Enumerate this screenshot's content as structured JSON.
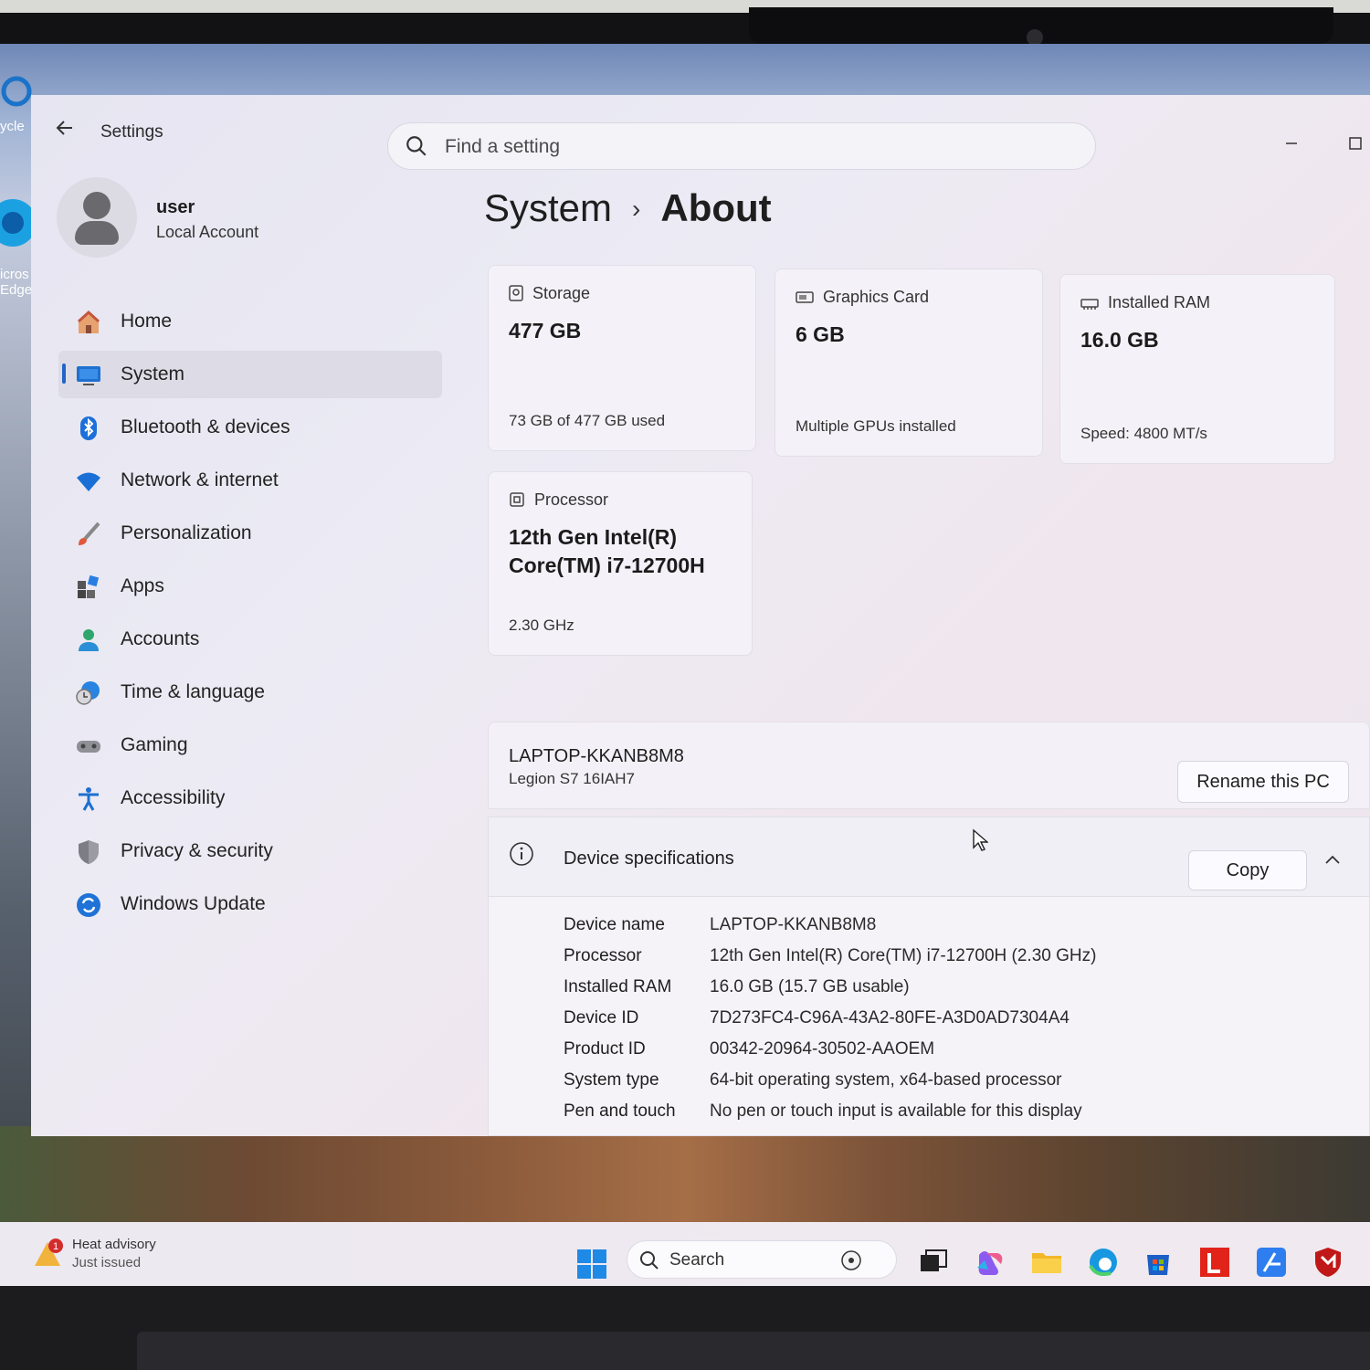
{
  "desktop": {
    "recycle_label": "ycle",
    "edge_label_1": "icros",
    "edge_label_2": "Edge"
  },
  "window": {
    "app_title": "Settings",
    "search_placeholder": "Find a setting"
  },
  "user": {
    "name": "user",
    "account_type": "Local Account"
  },
  "sidebar": {
    "items": [
      {
        "label": "Home",
        "icon": "home-icon"
      },
      {
        "label": "System",
        "icon": "system-icon",
        "active": true
      },
      {
        "label": "Bluetooth & devices",
        "icon": "bluetooth-icon"
      },
      {
        "label": "Network & internet",
        "icon": "wifi-icon"
      },
      {
        "label": "Personalization",
        "icon": "brush-icon"
      },
      {
        "label": "Apps",
        "icon": "apps-icon"
      },
      {
        "label": "Accounts",
        "icon": "accounts-icon"
      },
      {
        "label": "Time & language",
        "icon": "globe-clock-icon"
      },
      {
        "label": "Gaming",
        "icon": "gamepad-icon"
      },
      {
        "label": "Accessibility",
        "icon": "accessibility-icon"
      },
      {
        "label": "Privacy & security",
        "icon": "shield-icon"
      },
      {
        "label": "Windows Update",
        "icon": "update-icon"
      }
    ]
  },
  "breadcrumb": {
    "parent": "System",
    "separator": "›",
    "current": "About"
  },
  "cards": {
    "storage": {
      "title": "Storage",
      "value": "477 GB",
      "sub": "73 GB of 477 GB used"
    },
    "graphics": {
      "title": "Graphics Card",
      "value": "6 GB",
      "sub": "Multiple GPUs installed"
    },
    "ram": {
      "title": "Installed RAM",
      "value": "16.0 GB",
      "sub": "Speed: 4800 MT/s"
    },
    "processor": {
      "title": "Processor",
      "value_line1": "12th Gen Intel(R)",
      "value_line2": "Core(TM) i7-12700H",
      "sub": "2.30 GHz"
    }
  },
  "pc": {
    "name": "LAPTOP-KKANB8M8",
    "model": "Legion S7 16IAH7",
    "rename_label": "Rename this PC"
  },
  "specs": {
    "title": "Device specifications",
    "copy_label": "Copy",
    "chevron": "^",
    "rows": [
      {
        "key": "Device name",
        "value": "LAPTOP-KKANB8M8"
      },
      {
        "key": "Processor",
        "value": "12th Gen Intel(R) Core(TM) i7-12700H (2.30 GHz)"
      },
      {
        "key": "Installed RAM",
        "value": "16.0 GB (15.7 GB usable)"
      },
      {
        "key": "Device ID",
        "value": "7D273FC4-C96A-43A2-80FE-A3D0AD7304A4"
      },
      {
        "key": "Product ID",
        "value": "00342-20964-30502-AAOEM"
      },
      {
        "key": "System type",
        "value": "64-bit operating system, x64-based processor"
      },
      {
        "key": "Pen and touch",
        "value": "No pen or touch input is available for this display"
      }
    ]
  },
  "taskbar": {
    "weather_title": "Heat advisory",
    "weather_sub": "Just issued",
    "weather_badge": "1",
    "search_label": "Search",
    "pinned": [
      "start-icon",
      "task-view-icon",
      "copilot-icon",
      "file-explorer-icon",
      "edge-icon",
      "store-icon",
      "lenovo-vantage-icon",
      "app-icon",
      "mcafee-icon"
    ]
  },
  "colors": {
    "accent": "#2064c8",
    "window_bg": "#ebe8f2"
  }
}
